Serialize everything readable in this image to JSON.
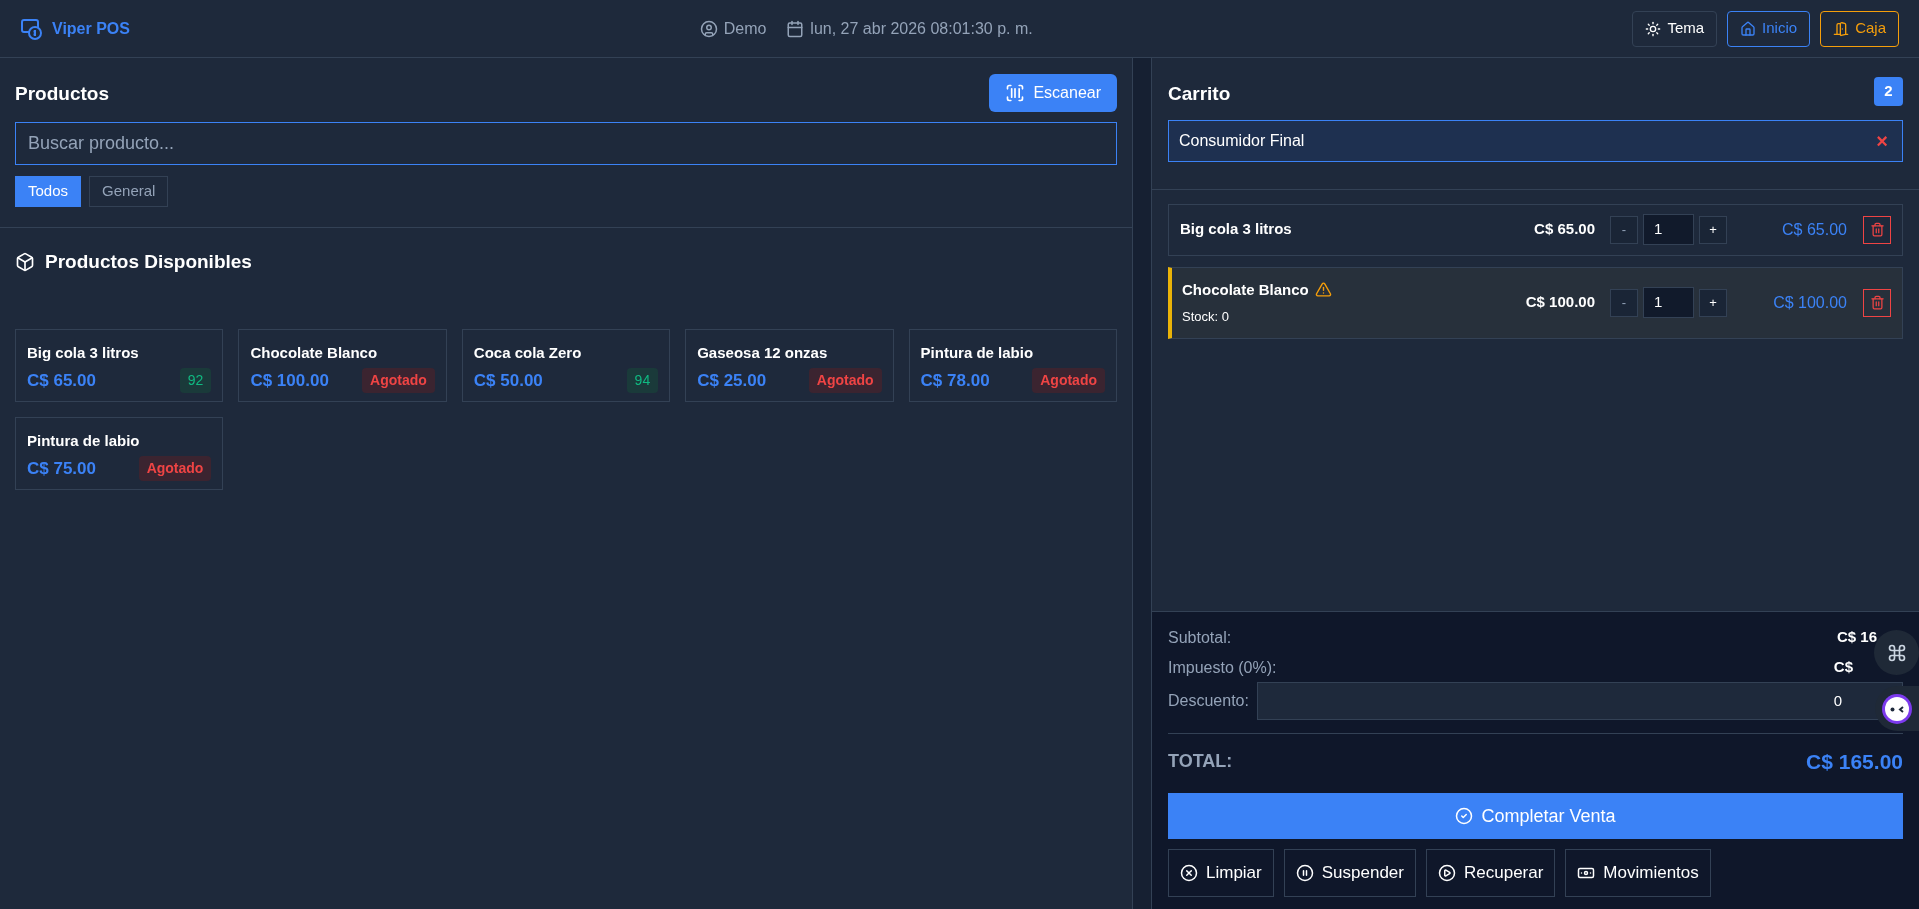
{
  "header": {
    "app_name": "Viper POS",
    "user": "Demo",
    "datetime": "lun, 27 abr 2026 08:01:30 p. m.",
    "buttons": [
      {
        "kind": "theme",
        "label": "Tema"
      },
      {
        "kind": "home",
        "label": "Inicio"
      },
      {
        "kind": "register",
        "label": "Caja"
      }
    ]
  },
  "products": {
    "title": "Productos",
    "scan_button": "Escanear",
    "search": {
      "placeholder": "Buscar producto..."
    },
    "categories": [
      {
        "label": "Todos",
        "selected": true
      },
      {
        "label": "General",
        "selected": false
      }
    ],
    "section_title": "Productos Disponibles",
    "items": [
      {
        "name": "Big cola 3 litros",
        "price": "C$ 65.00",
        "badge": "92",
        "kind": "stock"
      },
      {
        "name": "Chocolate Blanco",
        "price": "C$ 100.00",
        "badge": "Agotado",
        "kind": "out"
      },
      {
        "name": "Coca cola Zero",
        "price": "C$ 50.00",
        "badge": "94",
        "kind": "stock"
      },
      {
        "name": "Gaseosa 12 onzas",
        "price": "C$ 25.00",
        "badge": "Agotado",
        "kind": "out"
      },
      {
        "name": "Pintura de labio",
        "price": "C$ 78.00",
        "badge": "Agotado",
        "kind": "out"
      },
      {
        "name": "Pintura de labio",
        "price": "C$ 75.00",
        "badge": "Agotado",
        "kind": "out"
      }
    ]
  },
  "cart": {
    "title": "Carrito",
    "count": "2",
    "customer": "Consumidor Final",
    "clear_customer": "×",
    "items": [
      {
        "name": "Big cola 3 litros",
        "price": "C$ 65.00",
        "minus": "-",
        "quantity": "1",
        "plus": "+",
        "line_total": "C$ 65.00",
        "warning": false
      },
      {
        "name": "Chocolate Blanco",
        "stock": "Stock: 0",
        "price": "C$ 100.00",
        "minus": "-",
        "quantity": "1",
        "plus": "+",
        "line_total": "C$ 100.00",
        "warning": true
      }
    ],
    "summary": {
      "subtotal_label": "Subtotal:",
      "subtotal": "C$ 16",
      "tax_label": "Impuesto (0%):",
      "tax": "C$",
      "discount_label": "Descuento:",
      "discount": "0",
      "total_label": "TOTAL:",
      "total": "C$ 165.00"
    },
    "complete_button": "Completar Venta",
    "actions": [
      {
        "kind": "clear",
        "label": "Limpiar"
      },
      {
        "kind": "suspend",
        "label": "Suspender"
      },
      {
        "kind": "resume",
        "label": "Recuperar"
      },
      {
        "kind": "movements",
        "label": "Movimientos"
      }
    ]
  }
}
